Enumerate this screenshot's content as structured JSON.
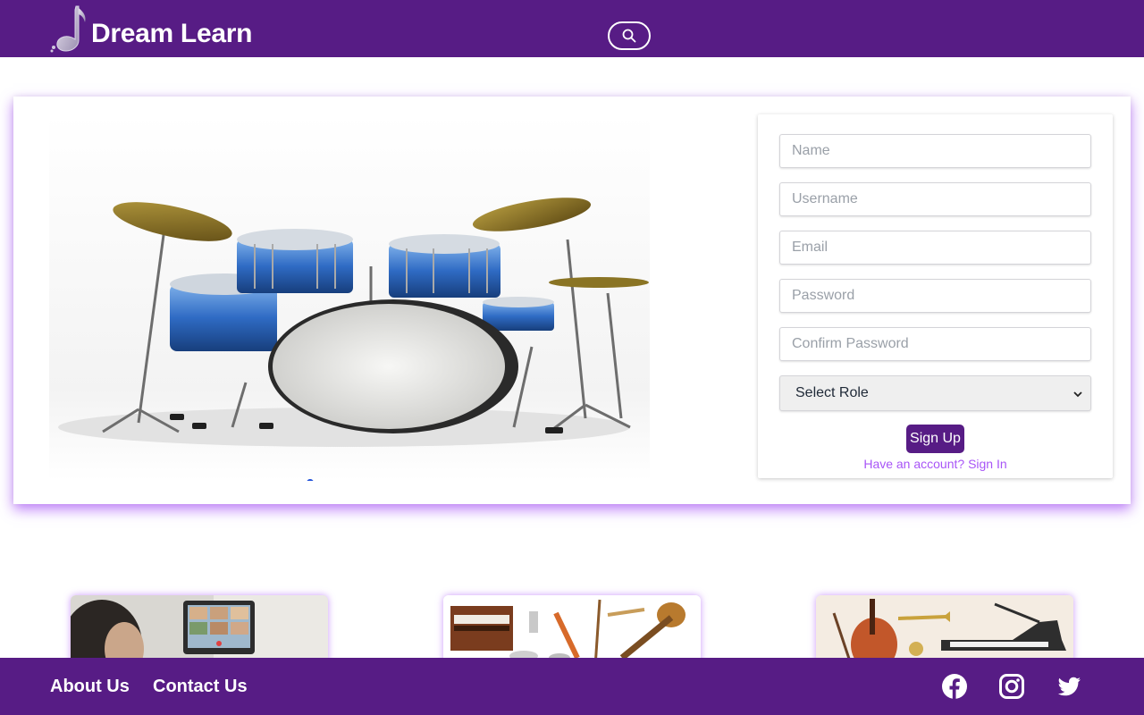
{
  "header": {
    "brand": "Dream Learn",
    "logo_icon": "music-note-icon",
    "search_icon": "search-icon"
  },
  "carousel": {
    "image": "drum-kit",
    "dots": 1
  },
  "signup_form": {
    "name_placeholder": "Name",
    "username_placeholder": "Username",
    "email_placeholder": "Email",
    "password_placeholder": "Password",
    "confirm_password_placeholder": "Confirm Password",
    "role_select": "Select Role",
    "submit_label": "Sign Up",
    "signin_link": "Have an account? Sign In"
  },
  "tiles": [
    {
      "image": "online-music-class"
    },
    {
      "image": "indian-instruments"
    },
    {
      "image": "western-instruments"
    }
  ],
  "footer": {
    "about": "About Us",
    "contact": "Contact Us",
    "social": [
      "facebook-icon",
      "instagram-icon",
      "twitter-icon"
    ]
  },
  "colors": {
    "brand": "#571c85",
    "accent": "#a855f7",
    "carousel_dot": "#1e4fd8"
  }
}
